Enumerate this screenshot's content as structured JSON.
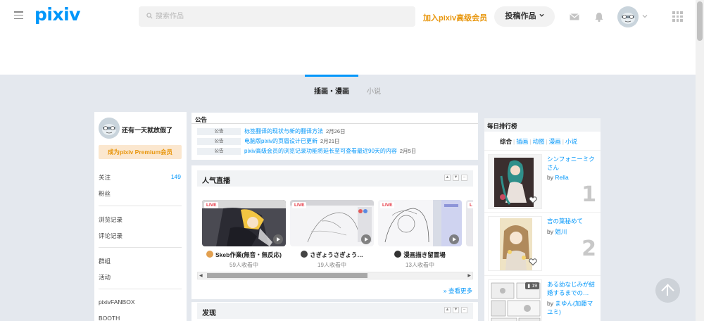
{
  "header": {
    "logo": "pixiv",
    "search_placeholder": "搜索作品",
    "premium_link": "加入pixiv高级会员",
    "post_button": "投稿作品"
  },
  "tabs": [
    {
      "label": "插画・漫画",
      "active": true
    },
    {
      "label": "小说",
      "active": false
    }
  ],
  "sidebar": {
    "username": "还有一天就放假了",
    "premium_button": "成为pixiv Premium会员",
    "items": [
      {
        "label": "关注",
        "count": "149"
      },
      {
        "label": "粉丝"
      },
      {
        "label": "浏览记录"
      },
      {
        "label": "评论记录"
      },
      {
        "label": "群组"
      },
      {
        "label": "活动"
      },
      {
        "label": "pixivFANBOX"
      },
      {
        "label": "BOOTH"
      }
    ]
  },
  "notice": {
    "title": "公告",
    "rows": [
      {
        "badge": "公告",
        "text": "标签翻译的现状与新的翻译方法",
        "date": "2月26日"
      },
      {
        "badge": "公告",
        "text": "电脑版pixiv的页眉设计已更新",
        "date": "2月21日"
      },
      {
        "badge": "公告",
        "text": "pixiv高级会员的浏览记录功能将延长至可查看最近90天的内容",
        "date": "2月5日"
      }
    ]
  },
  "live": {
    "title": "人气直播",
    "cards": [
      {
        "badge": "LIVE",
        "name": "Skeb作業(無音・無反応)",
        "viewers": "59人收看中"
      },
      {
        "badge": "LIVE",
        "name": "さぎょうさぎょう…",
        "viewers": "19人收看中"
      },
      {
        "badge": "LIVE",
        "name": "漫画描き留置場",
        "viewers": "13人收看中"
      }
    ],
    "more": "查看更多"
  },
  "discover": {
    "title": "发现"
  },
  "ranking": {
    "title": "每日排行榜",
    "tabs": [
      "综合",
      "插画",
      "动图",
      "漫画",
      "小说"
    ],
    "items": [
      {
        "title": "シンフォニーミクさん",
        "by": "by",
        "author": "Rella",
        "rank": "1"
      },
      {
        "title": "言の葉秘めて",
        "by": "by",
        "author": "姐川",
        "rank": "2"
      },
      {
        "title": "ある幼なじみが結婚するまでの…",
        "by": "by",
        "author": "まゆん(加藤マユミ)",
        "pages": "19"
      }
    ]
  },
  "colors": {
    "accent": "#0096fa",
    "premium": "#e8960d",
    "live": "#e42c3a"
  }
}
